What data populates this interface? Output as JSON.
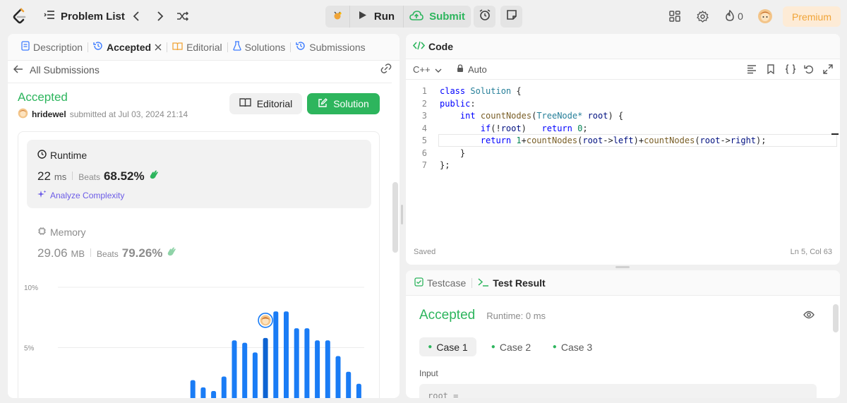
{
  "topbar": {
    "problem_list": "Problem List",
    "run": "Run",
    "submit": "Submit",
    "fire_count": "0",
    "premium": "Premium"
  },
  "left": {
    "tabs": [
      {
        "label": "Description"
      },
      {
        "label": "Accepted"
      },
      {
        "label": "Editorial"
      },
      {
        "label": "Solutions"
      },
      {
        "label": "Submissions"
      }
    ],
    "all_submissions": "All Submissions",
    "status": "Accepted",
    "user": "hridewel",
    "submitted_at": "submitted at Jul 03, 2024 21:14",
    "editorial_btn": "Editorial",
    "solution_btn": "Solution",
    "runtime": {
      "label": "Runtime",
      "value": "22",
      "unit": "ms",
      "beats_label": "Beats",
      "beats": "68.52%",
      "analyze": "Analyze Complexity"
    },
    "memory": {
      "label": "Memory",
      "value": "29.06",
      "unit": "MB",
      "beats_label": "Beats",
      "beats": "79.26%"
    }
  },
  "chart_data": {
    "type": "bar",
    "y_ticks": [
      "10%",
      "5%"
    ],
    "ylim": [
      0,
      10
    ],
    "values": [
      0.2,
      2.3,
      1.7,
      1.4,
      2.6,
      5.6,
      5.4,
      4.6,
      5.8,
      8.0,
      8.0,
      6.6,
      6.6,
      5.6,
      5.6,
      4.3,
      3.0,
      2.0
    ],
    "color": "#1a7cf5",
    "highlight_color": "#0e63d2",
    "highlight_index": 8
  },
  "code_panel": {
    "title": "Code",
    "language": "C++",
    "mode": "Auto",
    "saved": "Saved",
    "position": "Ln 5, Col 63",
    "lines": [
      {
        "n": "1",
        "text": "class Solution {"
      },
      {
        "n": "2",
        "text": "public:"
      },
      {
        "n": "3",
        "text": "    int countNodes(TreeNode* root) {"
      },
      {
        "n": "4",
        "text": "        if(!root)   return 0;"
      },
      {
        "n": "5",
        "text": "        return 1+countNodes(root->left)+countNodes(root->right);"
      },
      {
        "n": "6",
        "text": "    }"
      },
      {
        "n": "7",
        "text": "};"
      }
    ]
  },
  "test_panel": {
    "tab_testcase": "Testcase",
    "tab_result": "Test Result",
    "status": "Accepted",
    "runtime": "Runtime: 0 ms",
    "cases": [
      "Case 1",
      "Case 2",
      "Case 3"
    ],
    "input_label": "Input",
    "input_value": "root ="
  },
  "colors": {
    "green": "#2db55d",
    "blue": "#1a7cf5",
    "premium": "#f0a438"
  }
}
